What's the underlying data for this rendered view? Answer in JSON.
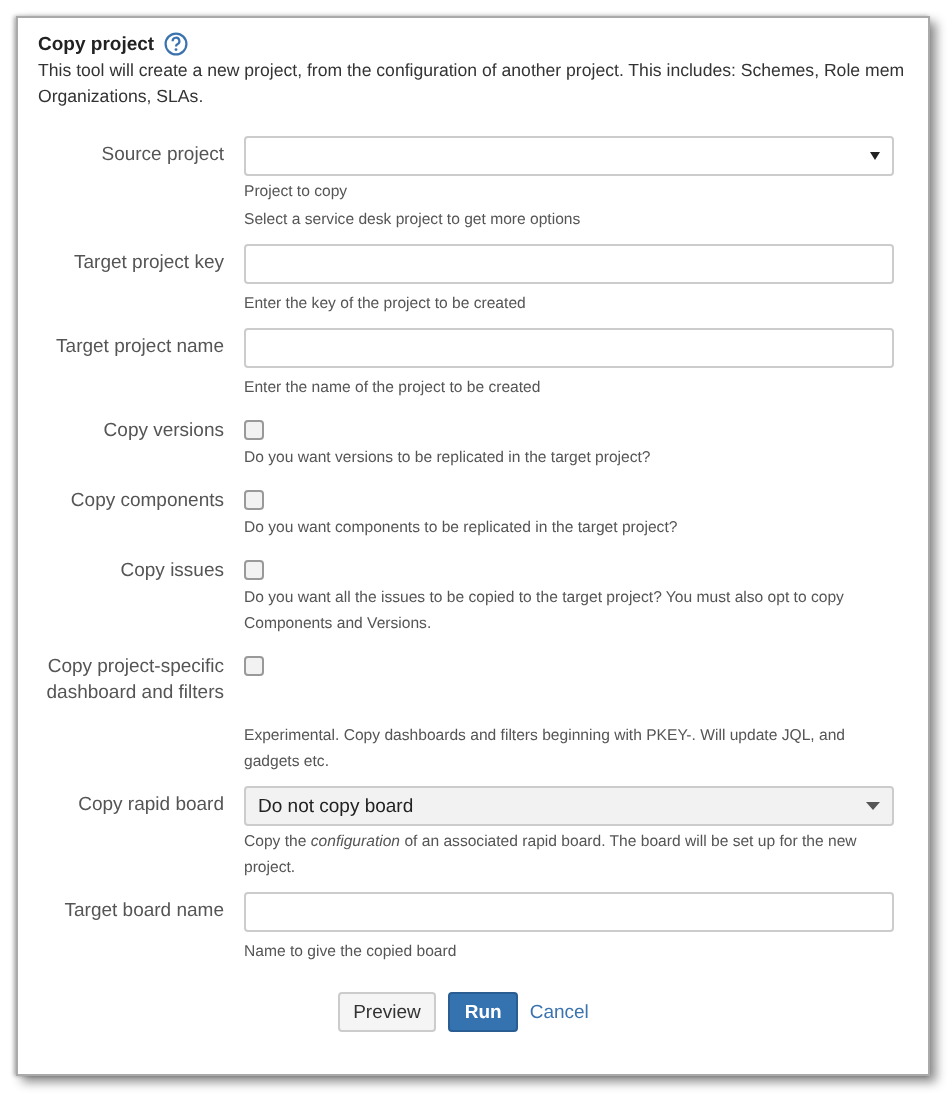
{
  "title": "Copy project",
  "intro_lines": [
    "This tool will create a new project, from the configuration of another project. This includes: Schemes, Role mem",
    "Organizations, SLAs."
  ],
  "fields": [
    {
      "kind": "select",
      "label": "Source project",
      "help": [
        "Project to copy",
        "Select a service desk project to get more options"
      ]
    },
    {
      "kind": "text",
      "label": "Target project key",
      "help": [
        "Enter the key of the project to be created"
      ]
    },
    {
      "kind": "text",
      "label": "Target project name",
      "help": [
        "Enter the name of the project to be created"
      ]
    },
    {
      "kind": "checkbox",
      "label": "Copy versions",
      "checked": false,
      "help": [
        "Do you want versions to be replicated in the target project?"
      ]
    },
    {
      "kind": "checkbox",
      "label": "Copy components",
      "checked": false,
      "help": [
        "Do you want components to be replicated in the target project?"
      ]
    },
    {
      "kind": "checkbox",
      "label": "Copy issues",
      "checked": false,
      "help": [
        "Do you want all the issues to be copied to the target project? You must also opt to copy Components and Versions."
      ]
    },
    {
      "kind": "checkbox",
      "label": "Copy project-specific dashboard and filters",
      "checked": false,
      "help": [
        "Experimental. Copy dashboards and filters beginning with PKEY-. Will update JQL, and gadgets etc."
      ]
    },
    {
      "kind": "dropdown",
      "label": "Copy rapid board",
      "value": "Do not copy board",
      "help": [
        "Copy the *configuration* of an associated rapid board. The board will be set up for the new project."
      ]
    },
    {
      "kind": "text",
      "label": "Target board name",
      "help": [
        "Name to give the copied board"
      ]
    }
  ],
  "buttons": [
    {
      "kind": "default",
      "label": "Preview"
    },
    {
      "kind": "primary",
      "label": "Run"
    },
    {
      "kind": "link",
      "label": "Cancel"
    }
  ]
}
